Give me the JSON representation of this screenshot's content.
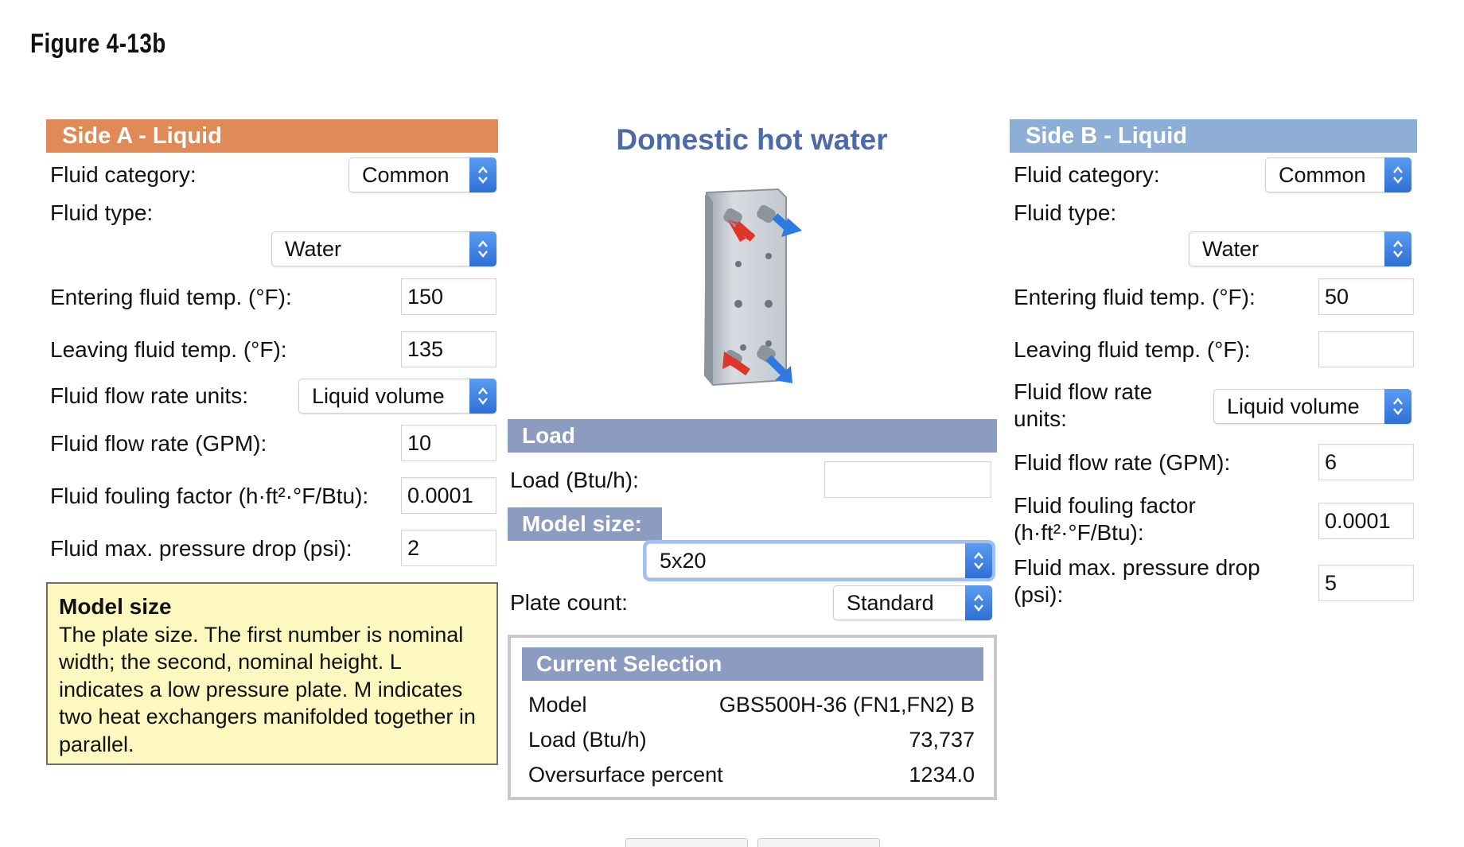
{
  "figure_title": "Figure 4-13b",
  "side_a": {
    "header": "Side A - Liquid",
    "fluid_category_label": "Fluid category:",
    "fluid_category_value": "Common",
    "fluid_type_label": "Fluid type:",
    "fluid_type_value": "Water",
    "entering_temp_label": "Entering fluid temp. (°F):",
    "entering_temp_value": "150",
    "leaving_temp_label": "Leaving fluid temp. (°F):",
    "leaving_temp_value": "135",
    "flow_units_label": "Fluid flow rate units:",
    "flow_units_value": "Liquid volume",
    "flow_rate_label": "Fluid flow rate (GPM):",
    "flow_rate_value": "10",
    "fouling_label": "Fluid fouling factor (h·ft²·°F/Btu):",
    "fouling_value": "0.0001",
    "pressure_drop_label": "Fluid max. pressure drop (psi):",
    "pressure_drop_value": "2"
  },
  "tooltip": {
    "title": "Model size",
    "text": "The plate size. The first number is nominal width; the second, nominal height. L indicates a low pressure plate. M indicates two heat exchangers manifolded together in parallel."
  },
  "center": {
    "title": "Domestic hot water",
    "load_header": "Load",
    "load_label": "Load (Btu/h):",
    "load_value": "",
    "model_size_header": "Model size:",
    "model_size_value": "5x20",
    "plate_count_label": "Plate count:",
    "plate_count_value": "Standard",
    "current_selection": {
      "header": "Current Selection",
      "rows": [
        {
          "label": "Model",
          "value": "GBS500H-36 (FN1,FN2) B"
        },
        {
          "label": "Load (Btu/h)",
          "value": "73,737"
        },
        {
          "label": "Oversurface percent",
          "value": "1234.0"
        }
      ]
    }
  },
  "side_b": {
    "header": "Side B - Liquid",
    "fluid_category_label": "Fluid category:",
    "fluid_category_value": "Common",
    "fluid_type_label": "Fluid type:",
    "fluid_type_value": "Water",
    "entering_temp_label": "Entering fluid temp. (°F):",
    "entering_temp_value": "50",
    "leaving_temp_label": "Leaving fluid temp. (°F):",
    "leaving_temp_value": "",
    "flow_units_label_line1": "Fluid flow rate",
    "flow_units_label_line2": "units:",
    "flow_units_value": "Liquid volume",
    "flow_rate_label": "Fluid flow rate (GPM):",
    "flow_rate_value": "6",
    "fouling_label_line1": "Fluid fouling factor",
    "fouling_label_line2": "(h·ft²·°F/Btu):",
    "fouling_value": "0.0001",
    "pressure_drop_label_line1": "Fluid max. pressure drop",
    "pressure_drop_label_line2": "(psi):",
    "pressure_drop_value": "5"
  },
  "colors": {
    "side_a_header": "#e08a58",
    "side_b_header": "#8eaed6",
    "section_bar": "#8c9bc0",
    "title_blue": "#4d6aa8",
    "tooltip_bg": "#fcf8c0",
    "stepper_blue": "#2f6fd6",
    "hot_arrow": "#e0362a",
    "cold_arrow": "#2f7ae0"
  },
  "icons": {
    "stepper": "up-down-chevron-icon",
    "heat_exchanger": "plate-heat-exchanger-icon"
  }
}
